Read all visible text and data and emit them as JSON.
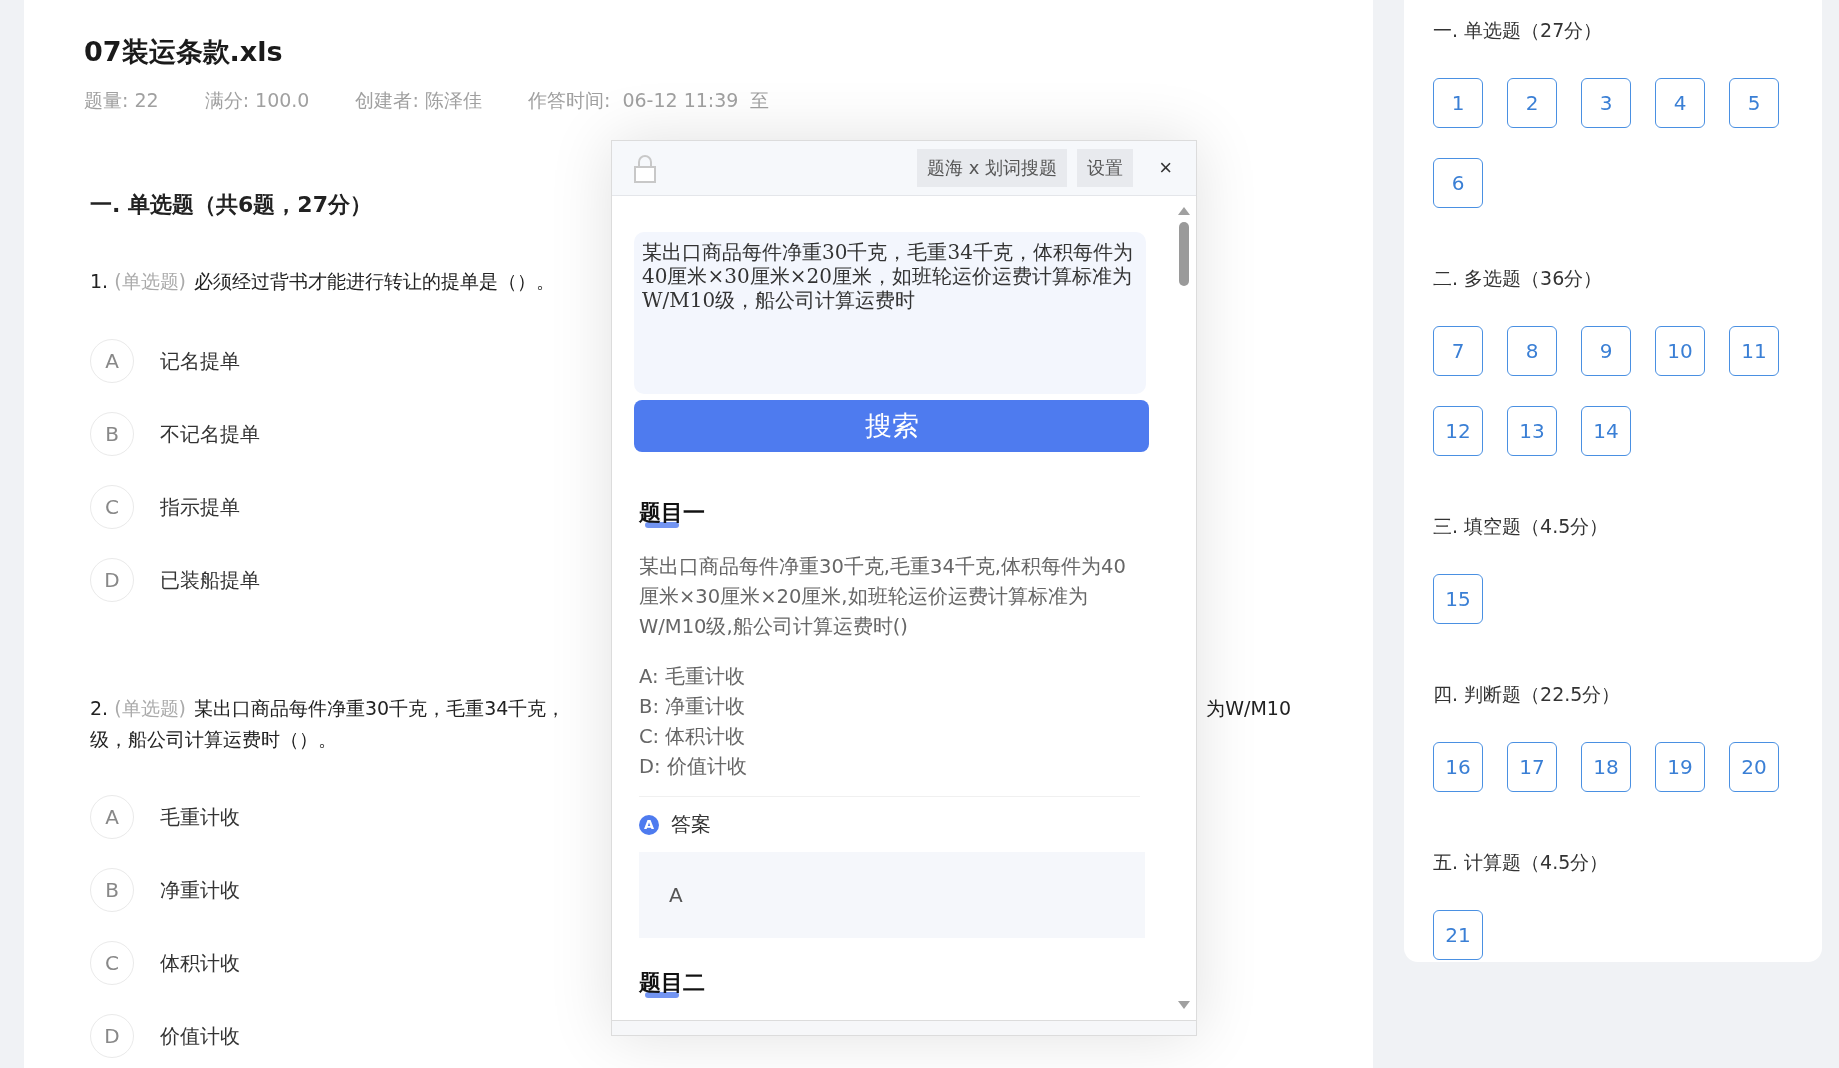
{
  "exam": {
    "title": "07装运条款.xls",
    "meta": [
      "题量: 22",
      "满分: 100.0",
      "创建者: 陈泽佳",
      "作答时间:  06-12 11:39  至"
    ],
    "section_heading": "一. 单选题（共6题，27分）",
    "questions": [
      {
        "number": "1.",
        "type": "(单选题)",
        "lines": [
          [
            "必须经过背书才能进行转让的提单是（）。"
          ]
        ],
        "options": [
          {
            "letter": "A",
            "text": "记名提单"
          },
          {
            "letter": "B",
            "text": "不记名提单"
          },
          {
            "letter": "C",
            "text": "指示提单"
          },
          {
            "letter": "D",
            "text": "已装船提单"
          }
        ]
      },
      {
        "number": "2.",
        "type": "(单选题)",
        "lines": [
          [
            "某出口商品每件净重30千克，毛重34千克，",
            "为W/M10"
          ],
          [
            "级，船公司计算运费时（）。"
          ]
        ],
        "options": [
          {
            "letter": "A",
            "text": "毛重计收"
          },
          {
            "letter": "B",
            "text": "净重计收"
          },
          {
            "letter": "C",
            "text": "体积计收"
          },
          {
            "letter": "D",
            "text": "价值计收"
          }
        ]
      }
    ]
  },
  "search_popup": {
    "header_buttons": [
      "题海 x 划词搜题",
      "设置"
    ],
    "close": "×",
    "query": "某出口商品每件净重30千克，毛重34千克，体积每件为40厘米×30厘米×20厘米，如班轮运价运费计算标准为W/M10级，船公司计算运费时",
    "search_button": "搜索",
    "results": [
      {
        "heading": "题目一",
        "question": "某出口商品每件净重30千克,毛重34千克,体积每件为40厘米×30厘米×20厘米,如班轮运价运费计算标准为W/M10级,船公司计算运费时()",
        "options": [
          "A: 毛重计收",
          "B: 净重计收",
          "C: 体积计收",
          "D: 价值计收"
        ],
        "answer_label": "答案",
        "answer_badge": "A",
        "answer": "A"
      },
      {
        "heading": "题目二"
      }
    ]
  },
  "sidebar": {
    "sections": [
      {
        "title": "一. 单选题（27分）",
        "numbers": [
          "1",
          "2",
          "3",
          "4",
          "5",
          "6"
        ]
      },
      {
        "title": "二. 多选题（36分）",
        "numbers": [
          "7",
          "8",
          "9",
          "10",
          "11",
          "12",
          "13",
          "14"
        ]
      },
      {
        "title": "三. 填空题（4.5分）",
        "numbers": [
          "15"
        ]
      },
      {
        "title": "四. 判断题（22.5分）",
        "numbers": [
          "16",
          "17",
          "18",
          "19",
          "20"
        ]
      },
      {
        "title": "五. 计算题（4.5分）",
        "numbers": [
          "21"
        ]
      }
    ]
  }
}
